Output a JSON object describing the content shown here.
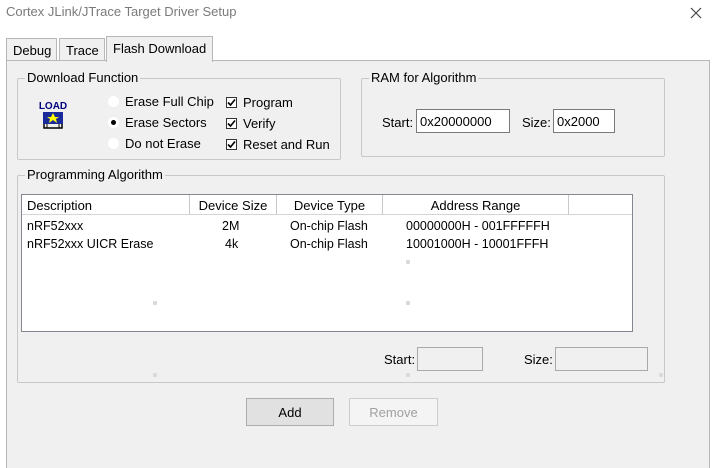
{
  "window": {
    "title": "Cortex JLink/JTrace Target Driver Setup",
    "close_icon": "close-icon"
  },
  "tabs": [
    {
      "label": "Debug",
      "active": false
    },
    {
      "label": "Trace",
      "active": false
    },
    {
      "label": "Flash Download",
      "active": true
    }
  ],
  "download_function": {
    "label": "Download Function",
    "icon": "load-icon",
    "icon_text": "LOAD",
    "radios": [
      {
        "label": "Erase Full Chip",
        "selected": false
      },
      {
        "label": "Erase Sectors",
        "selected": true
      },
      {
        "label": "Do not Erase",
        "selected": false
      }
    ],
    "checks": [
      {
        "label": "Program",
        "checked": true
      },
      {
        "label": "Verify",
        "checked": true
      },
      {
        "label": "Reset and Run",
        "checked": true
      }
    ]
  },
  "ram_for_algorithm": {
    "label": "RAM for Algorithm",
    "start_label": "Start:",
    "start_value": "0x20000000",
    "size_label": "Size:",
    "size_value": "0x2000"
  },
  "programming_algorithm": {
    "label": "Programming Algorithm",
    "columns": [
      "Description",
      "Device Size",
      "Device Type",
      "Address Range"
    ],
    "rows": [
      {
        "description": "nRF52xxx",
        "device_size": "2M",
        "device_type": "On-chip Flash",
        "address_range": "00000000H - 001FFFFFH"
      },
      {
        "description": "nRF52xxx UICR Erase",
        "device_size": "4k",
        "device_type": "On-chip Flash",
        "address_range": "10001000H - 10001FFFH"
      }
    ],
    "start_label": "Start:",
    "start_value": "",
    "size_label": "Size:",
    "size_value": ""
  },
  "buttons": {
    "add_label": "Add",
    "remove_label": "Remove"
  }
}
